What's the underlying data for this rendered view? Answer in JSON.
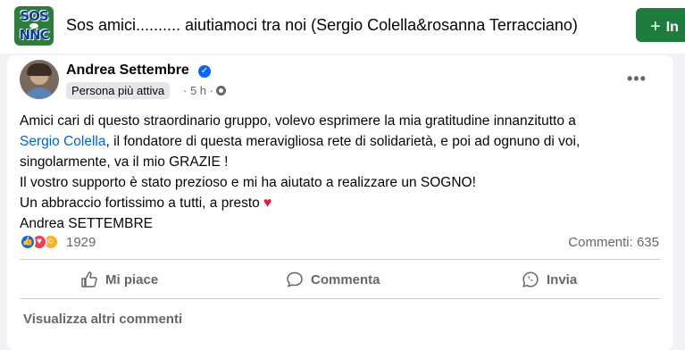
{
  "group": {
    "logo_top": "SOS",
    "logo_bottom": "NNC",
    "title": "Sos amici.......... aiutiamoci tra noi (Sergio Colella&rosanna Terracciano)",
    "join_label": "In"
  },
  "post": {
    "author": "Andrea Settembre",
    "badge": "Persona più attiva",
    "time": "· 5 h ·",
    "lines": [
      "Amici cari di questo straordinario gruppo, volevo esprimere la mia gratitudine innanzitutto a",
      "il fondatore di questa meravigliosa rete di solidarietà, e poi ad ognuno di voi,",
      "singolarmente, va il mio GRAZIE !",
      "Il vostro supporto è stato prezioso e mi ha aiutato a realizzare un SOGNO!",
      "Un abbraccio fortissimo a tutti, a presto",
      "Andrea SETTEMBRE"
    ],
    "mention": "Sergio Colella",
    "mention_suffix": ",",
    "heart": "♥"
  },
  "stats": {
    "reactions": "1929",
    "comments": "Commenti: 635"
  },
  "actions": {
    "like": "Mi piace",
    "comment": "Commenta",
    "share": "Invia"
  },
  "more_comments": "Visualizza altri commenti",
  "colors": {
    "primary": "#0866ff",
    "join_green": "#1e7c3f",
    "link": "#0064d1",
    "heart": "#e41e3f"
  }
}
